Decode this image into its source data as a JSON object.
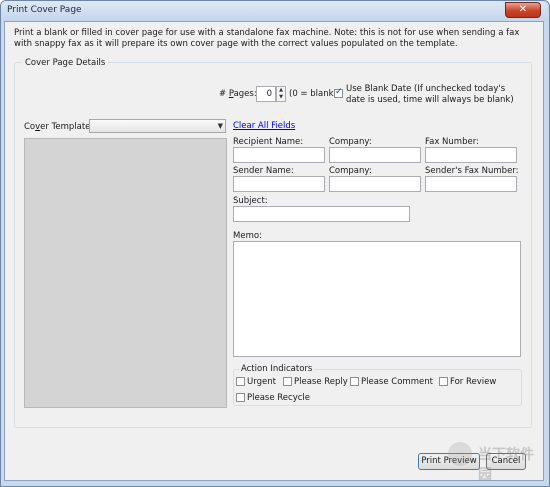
{
  "window": {
    "title": "Print Cover Page",
    "close_label": "✕"
  },
  "intro_text": "Print a blank or filled in cover page for use with a standalone fax machine.  Note: this is not for use when sending a fax with snappy fax as it will prepare its own cover page with the correct values populated on the template.",
  "details": {
    "legend": "Cover Page Details",
    "pages_label_pre": "# ",
    "pages_label_ul": "P",
    "pages_label_post": "ages:",
    "pages_value": "0",
    "pages_hint": "(0 = blank)",
    "use_blank_date_checked": true,
    "use_blank_date_label": "Use Blank Date (If unchecked today's date is used, time will always be blank)",
    "cover_template_label_pre": "Co",
    "cover_template_label_ul": "v",
    "cover_template_label_post": "er Template:",
    "cover_template_value": "",
    "clear_all_label": "Clear All Fields",
    "recipient_name_label": "Recipient Name:",
    "recipient_company_label": "Company:",
    "fax_number_label": "Fax Number:",
    "sender_name_label": "Sender Name:",
    "sender_company_label": "Company:",
    "sender_fax_label": "Sender's Fax Number:",
    "subject_label": "Subject:",
    "memo_label": "Memo:"
  },
  "action_indicators": {
    "legend": "Action Indicators",
    "urgent": "Urgent",
    "please_reply": "Please Reply",
    "please_comment": "Please Comment",
    "for_review": "For Review",
    "please_recycle": "Please Recycle"
  },
  "buttons": {
    "print_preview": "Print Preview",
    "cancel": "Cancel"
  },
  "watermark_text": "当下软件园"
}
